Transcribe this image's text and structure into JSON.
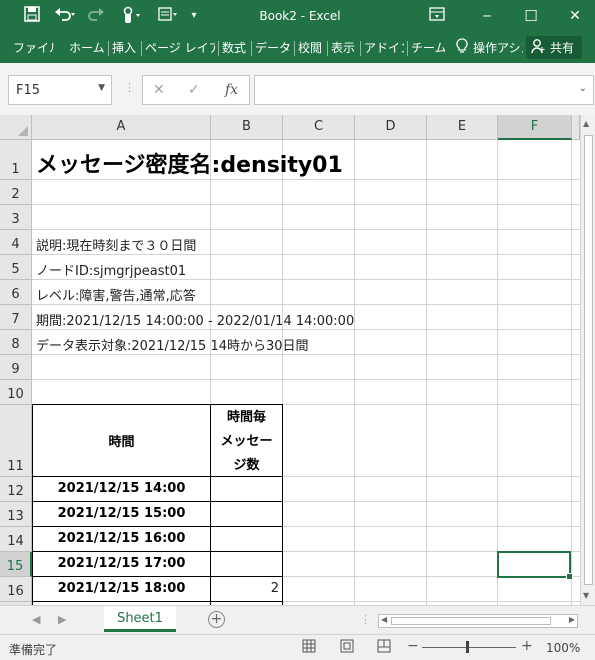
{
  "window": {
    "title": "Book2 - Excel",
    "qat": {
      "save_icon": "save-icon",
      "undo_icon": "undo-icon",
      "redo_icon": "redo-icon",
      "touch_icon": "touch-mode-icon",
      "form_icon": "form-icon",
      "customize_icon": "customize-icon"
    },
    "controls": {
      "ribbon_display_icon": "ribbon-display-icon",
      "minimize_glyph": "─",
      "maximize_glyph": "☐",
      "close_glyph": "✕"
    }
  },
  "ribbon": {
    "tabs": [
      {
        "label": "ファイル"
      },
      {
        "label": "ホーム"
      },
      {
        "label": "挿入"
      },
      {
        "label": "ページ レイアウト"
      },
      {
        "label": "数式"
      },
      {
        "label": "データ"
      },
      {
        "label": "校閲"
      },
      {
        "label": "表示"
      },
      {
        "label": "アドイン"
      },
      {
        "label": "チーム"
      }
    ],
    "tell_me": "操作アシスト",
    "share_label": "共有"
  },
  "formula_bar": {
    "name_box": "F15",
    "cancel_glyph": "✕",
    "enter_glyph": "✓",
    "fx_glyph": "fx",
    "formula": ""
  },
  "grid": {
    "columns": [
      "A",
      "B",
      "C",
      "D",
      "E",
      "F"
    ],
    "selected_column": "F",
    "rows": [
      "1",
      "2",
      "3",
      "4",
      "5",
      "6",
      "7",
      "8",
      "9",
      "10",
      "11",
      "12",
      "13",
      "14",
      "15",
      "16"
    ],
    "selected_row": "15",
    "cells": {
      "A1": "メッセージ密度名:density01",
      "A4": "説明:現在時刻まで３０日間",
      "A5": "ノードID:sjmgrjpeast01",
      "A6": "レベル:障害,警告,通常,応答",
      "A7": "期間:2021/12/15 14:00:00 - 2022/01/14 14:00:00",
      "A8": "データ表示対象:2021/12/15 14時から30日間",
      "A11": "時間",
      "B11": "時間毎メッセージ数",
      "B11_lines": [
        "時間毎",
        "メッセー",
        "ジ数"
      ],
      "A12": "2021/12/15 14:00",
      "A13": "2021/12/15 15:00",
      "A14": "2021/12/15 16:00",
      "A15": "2021/12/15 17:00",
      "A16": "2021/12/15 18:00",
      "B16": "2"
    }
  },
  "sheets": {
    "tabs": [
      "Sheet1"
    ],
    "active": "Sheet1",
    "add_glyph": "+"
  },
  "status": {
    "ready": "準備完了",
    "zoom_minus": "−",
    "zoom_plus": "+",
    "zoom": "100%"
  },
  "colors": {
    "accent": "#217346",
    "accent_dark": "#185c37"
  }
}
